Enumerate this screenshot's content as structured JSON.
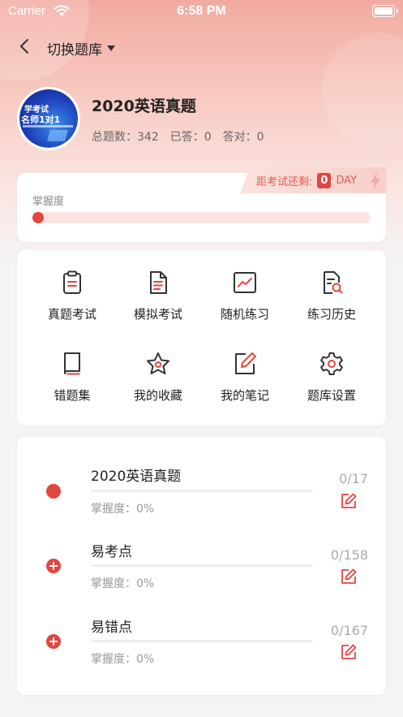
{
  "status_bar": {
    "carrier": "Carrier",
    "time": "6:58 PM"
  },
  "nav": {
    "switch_label": "切换题库"
  },
  "book": {
    "title": "2020英语真题",
    "avatar_text_1": "学考试",
    "avatar_text_2": "名师1对1",
    "stats": [
      {
        "label": "总题数：",
        "value": "342"
      },
      {
        "label": "已答：",
        "value": "0"
      },
      {
        "label": "答对：",
        "value": "0"
      }
    ]
  },
  "mastery": {
    "label": "掌握度",
    "value_percent": 0,
    "countdown_prefix": "距考试还剩:",
    "countdown_days": "0",
    "countdown_unit": "DAY"
  },
  "grid": [
    {
      "label": "真题考试",
      "icon": "clipboard-icon"
    },
    {
      "label": "模拟考试",
      "icon": "document-icon"
    },
    {
      "label": "随机练习",
      "icon": "chart-icon"
    },
    {
      "label": "练习历史",
      "icon": "history-search-icon"
    },
    {
      "label": "错题集",
      "icon": "book-icon"
    },
    {
      "label": "我的收藏",
      "icon": "star-icon"
    },
    {
      "label": "我的笔记",
      "icon": "note-edit-icon"
    },
    {
      "label": "题库设置",
      "icon": "gear-icon"
    }
  ],
  "sections": [
    {
      "name": "2020英语真题",
      "mastery_label": "掌握度：0%",
      "mastery_percent": 0,
      "count": "0/17",
      "marker": "dot"
    },
    {
      "name": "易考点",
      "mastery_label": "掌握度：0%",
      "mastery_percent": 0,
      "count": "0/158",
      "marker": "plus"
    },
    {
      "name": "易错点",
      "mastery_label": "掌握度：0%",
      "mastery_percent": 0,
      "count": "0/167",
      "marker": "plus"
    }
  ],
  "colors": {
    "accent": "#e24640",
    "hero_top": "#f2aaa0",
    "page_bg": "#f4f4f6"
  }
}
